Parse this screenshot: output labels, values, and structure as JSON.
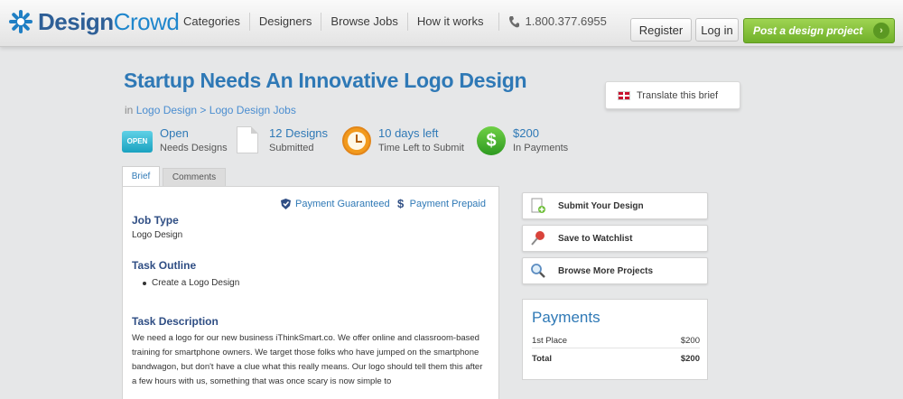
{
  "brand": {
    "name_a": "Design",
    "name_b": "Crowd"
  },
  "nav": {
    "items": [
      "Categories",
      "Designers",
      "Browse Jobs",
      "How it works"
    ],
    "phone": "1.800.377.6955"
  },
  "header_buttons": {
    "register": "Register",
    "login": "Log in",
    "post": "Post a design project"
  },
  "project": {
    "title": "Startup Needs An Innovative Logo Design",
    "breadcrumb_in": "in",
    "breadcrumb_1": "Logo Design",
    "breadcrumb_sep": ">",
    "breadcrumb_2": "Logo Design Jobs",
    "translate": "Translate this brief"
  },
  "stats": {
    "status_badge": "OPEN",
    "status": "Open",
    "status_sub": "Needs Designs",
    "designs": "12 Designs",
    "designs_sub": "Submitted",
    "time": "10 days left",
    "time_sub": "Time Left to Submit",
    "payment": "$200",
    "payment_sub": "In Payments"
  },
  "tabs": [
    "Brief",
    "Comments"
  ],
  "brief": {
    "guarantee_1": "Payment Guaranteed",
    "guarantee_2": "Payment Prepaid",
    "job_type_h": "Job Type",
    "job_type": "Logo Design",
    "task_outline_h": "Task Outline",
    "task_outline_item": "Create a Logo Design",
    "task_desc_h": "Task Description",
    "task_desc": "We need a logo for our new business iThinkSmart.co. We offer online and classroom-based training for smartphone owners. We target those folks who have jumped on the smartphone bandwagon, but don't have a clue what this really means. Our logo should tell them this after a few hours with us, something that was once scary is now simple to"
  },
  "actions": [
    "Submit Your Design",
    "Save to Watchlist",
    "Browse More Projects"
  ],
  "payments": {
    "title": "Payments",
    "rows": [
      {
        "label": "1st Place",
        "amount": "$200"
      }
    ],
    "total_label": "Total",
    "total_amount": "$200"
  },
  "colors": {
    "accent": "#2f79b6",
    "post_button": "#86c23a",
    "background": "#e6e7e8"
  }
}
